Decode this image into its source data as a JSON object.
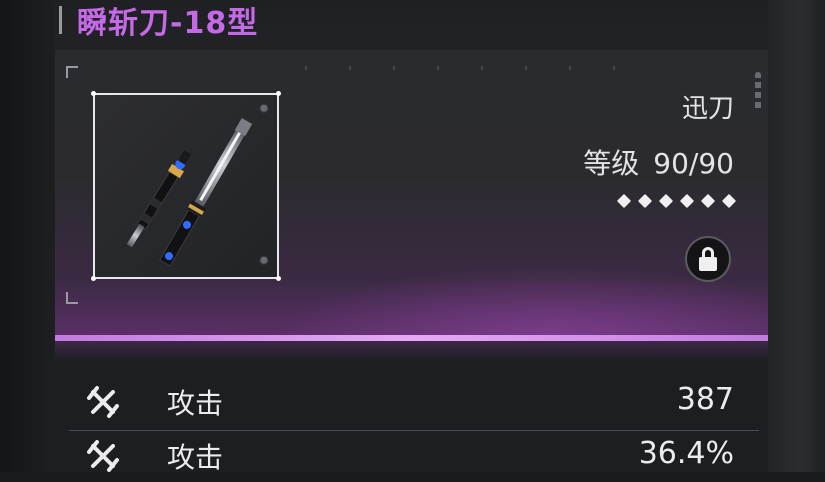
{
  "weapon": {
    "name": "瞬斩刀-18型",
    "type": "迅刀",
    "level_label": "等级",
    "level": "90/90",
    "stars": 6,
    "locked": true
  },
  "stats": [
    {
      "icon": "crossed-swords-icon",
      "name": "攻击",
      "value": "387"
    },
    {
      "icon": "crossed-swords-icon",
      "name": "攻击",
      "value": "36.4%"
    }
  ],
  "colors": {
    "title": "#c56ae6",
    "accent_glow": "#d98ef0",
    "text": "#ececee"
  }
}
